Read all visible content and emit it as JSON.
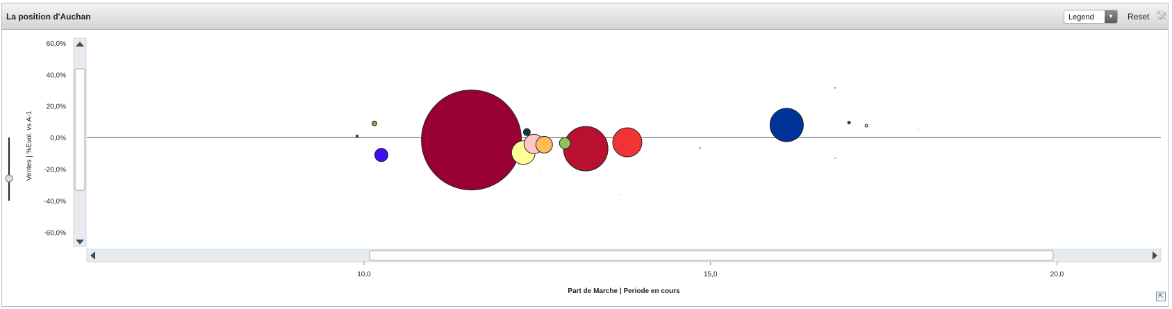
{
  "header": {
    "title": "La position d'Auchan",
    "legend_label": "Legend",
    "reset_label": "Reset"
  },
  "chart_data": {
    "type": "scatter",
    "subtype": "bubble",
    "title": "",
    "xlabel": "Part de Marche | Periode en cours",
    "ylabel": "Ventes | %Evol. vs A-1",
    "x_ticks": [
      "10,0",
      "15,0",
      "20,0"
    ],
    "x_tick_values": [
      10,
      15,
      20
    ],
    "y_ticks": [
      "60,0%",
      "40,0%",
      "20,0%",
      "0,0%",
      "-20,0%",
      "-40,0%",
      "-60,0%"
    ],
    "y_tick_values": [
      60,
      40,
      20,
      0,
      -20,
      -40,
      -60
    ],
    "xlim": [
      6.0,
      21.5
    ],
    "ylim": [
      -69,
      63
    ],
    "reference_line_y": 0,
    "grid": false,
    "legend": "hidden",
    "points": [
      {
        "x": 9.9,
        "y": 1.0,
        "size": 1.5,
        "color": "#1f4e9a"
      },
      {
        "x": 10.15,
        "y": 9.0,
        "size": 3.5,
        "color": "#9b9b50"
      },
      {
        "x": 10.25,
        "y": -11.0,
        "size": 9.5,
        "color": "#3d0cf0"
      },
      {
        "x": 11.55,
        "y": -1.5,
        "size": 72,
        "color": "#990033"
      },
      {
        "x": 12.35,
        "y": 3.5,
        "size": 5,
        "color": "#0d3d38"
      },
      {
        "x": 12.45,
        "y": -4.0,
        "size": 14,
        "color": "#ffc8c8"
      },
      {
        "x": 12.6,
        "y": -4.5,
        "size": 12,
        "color": "#ffbb55"
      },
      {
        "x": 12.3,
        "y": -9.5,
        "size": 17,
        "color": "#ffff99"
      },
      {
        "x": 12.9,
        "y": -3.5,
        "size": 8,
        "color": "#8fc35a"
      },
      {
        "x": 13.2,
        "y": -7.0,
        "size": 32,
        "color": "#b8102e"
      },
      {
        "x": 13.8,
        "y": -3.0,
        "size": 21,
        "color": "#f23333"
      },
      {
        "x": 14.85,
        "y": -6.5,
        "size": 1,
        "color": "#555555"
      },
      {
        "x": 16.1,
        "y": 8.0,
        "size": 24,
        "color": "#003399"
      },
      {
        "x": 16.8,
        "y": 31.5,
        "size": 1,
        "color": "#555555"
      },
      {
        "x": 17.0,
        "y": 9.5,
        "size": 2,
        "color": "#4a4a2a"
      },
      {
        "x": 17.25,
        "y": 7.5,
        "size": 2,
        "color": "#e8e8c0"
      },
      {
        "x": 16.8,
        "y": -13.0,
        "size": 0.8,
        "color": "#555555"
      },
      {
        "x": 13.7,
        "y": -36.0,
        "size": 0.6,
        "color": "#777777"
      },
      {
        "x": 18.0,
        "y": 5.0,
        "size": 0.6,
        "color": "#777777"
      },
      {
        "x": 12.55,
        "y": -21.5,
        "size": 0.6,
        "color": "#777777"
      }
    ],
    "colors": {
      "reference_line": "#888888",
      "axis_text": "#222222",
      "scrollbar_track": "#e6ebf0"
    }
  }
}
